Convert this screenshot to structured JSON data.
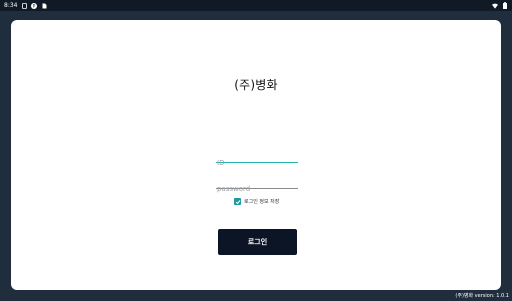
{
  "status_bar": {
    "time": "8:34",
    "icons_left": [
      "sim-icon",
      "p-icon",
      "file-icon"
    ],
    "icons_right": [
      "wifi-icon",
      "battery-icon"
    ]
  },
  "login": {
    "title": "(주)병화",
    "id_placeholder": "ID",
    "id_value": "",
    "password_placeholder": "password",
    "password_value": "",
    "remember_label": "로그인 정보 저장",
    "remember_checked": true,
    "login_button": "로그인"
  },
  "footer": {
    "version": "(주)병화 version: 1.0.1"
  },
  "colors": {
    "background": "#1f2d3d",
    "status_bar": "#0f1a26",
    "card": "#ffffff",
    "accent_teal": "#23b3b3",
    "button": "#0c1526"
  }
}
